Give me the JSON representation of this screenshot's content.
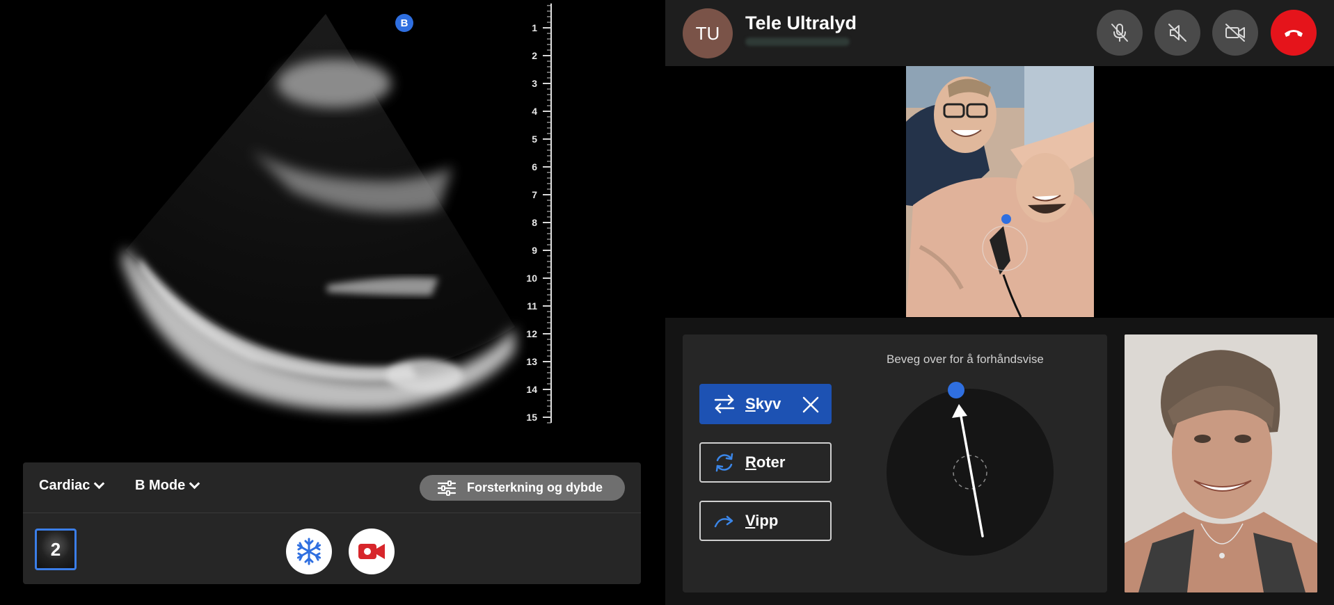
{
  "ultrasound": {
    "marker_label": "B",
    "depth_labels": [
      "1",
      "2",
      "3",
      "4",
      "5",
      "6",
      "7",
      "8",
      "9",
      "10",
      "11",
      "12",
      "13",
      "14",
      "15"
    ],
    "preset": "Cardiac",
    "mode": "B Mode",
    "gain_button_label": "Forsterkning og dybde",
    "clip_count": "2",
    "icons": {
      "preset_chevron": "chevron-down-icon",
      "sliders": "sliders-icon",
      "freeze": "snowflake-icon",
      "record": "video-record-icon"
    },
    "colors": {
      "accent": "#2f6fe0",
      "record": "#d7262b"
    }
  },
  "call": {
    "avatar_initials": "TU",
    "title": "Tele Ultralyd",
    "controls": [
      "mic-off-icon",
      "speaker-off-icon",
      "camera-off-icon",
      "hang-up-icon"
    ],
    "end_call_color": "#e5141b"
  },
  "guidance": {
    "buttons": [
      {
        "label_first": "S",
        "label_rest": "kyv",
        "icon": "swap-arrows-icon",
        "active": true
      },
      {
        "label_first": "R",
        "label_rest": "oter",
        "icon": "rotate-icon",
        "active": false
      },
      {
        "label_first": "V",
        "label_rest": "ipp",
        "icon": "tilt-arrow-icon",
        "active": false
      }
    ],
    "hint_text": "Beveg over for å forhåndsvise"
  }
}
